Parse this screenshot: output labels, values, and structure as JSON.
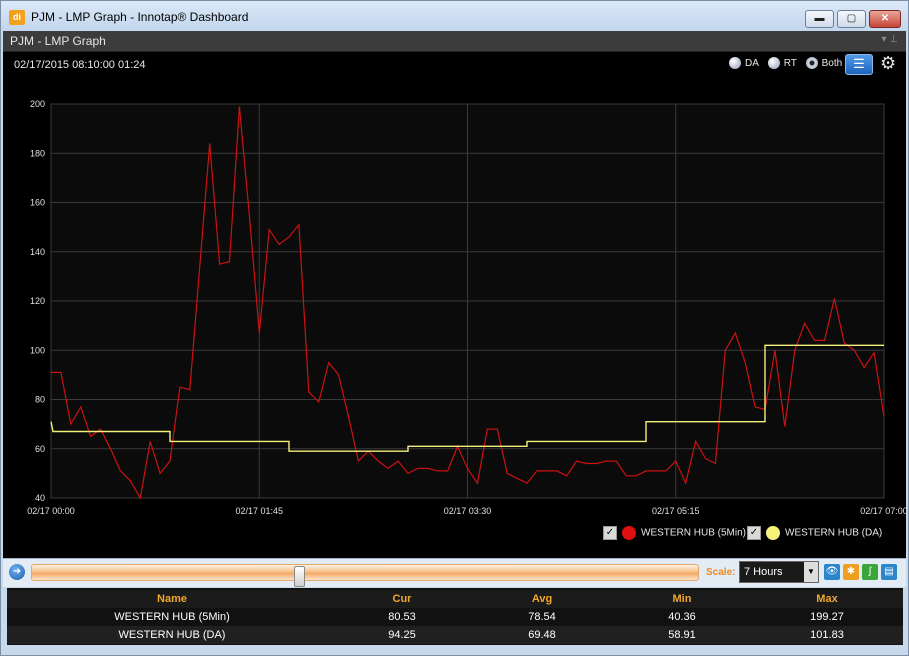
{
  "window": {
    "title": "PJM - LMP Graph - Innotap® Dashboard",
    "icon_text": "di",
    "buttons": {
      "minimize": "▬",
      "maximize": "▢",
      "close": "✕"
    }
  },
  "panel": {
    "title": "PJM - LMP Graph",
    "pin_icons": "▾ ⊥"
  },
  "header": {
    "datetime": "02/17/2015 08:10:00  01:24",
    "radios": [
      {
        "label": "DA",
        "selected": false
      },
      {
        "label": "RT",
        "selected": false
      },
      {
        "label": "Both",
        "selected": true
      }
    ],
    "list_icon": "☰",
    "gear_icon": "⚙"
  },
  "chart_data": {
    "type": "line",
    "ylim": [
      40,
      200
    ],
    "yticks": [
      "200",
      "180",
      "160",
      "140",
      "120",
      "100",
      "80",
      "60",
      "40"
    ],
    "ytick_values": [
      200,
      180,
      160,
      140,
      120,
      100,
      80,
      60,
      40
    ],
    "xlim_minutes": [
      0,
      420
    ],
    "xtick_labels": [
      "02/17 00:00",
      "02/17 01:45",
      "02/17 03:30",
      "02/17 05:15",
      "02/17 07:00"
    ],
    "xtick_minutes": [
      0,
      105,
      210,
      315,
      420
    ],
    "grid": true,
    "legend_position": "bottom-right",
    "series": [
      {
        "name": "WESTERN HUB (5Min)",
        "color": "#cc1111",
        "points": [
          [
            0,
            91
          ],
          [
            5,
            91
          ],
          [
            10,
            70
          ],
          [
            15,
            77
          ],
          [
            20,
            65
          ],
          [
            25,
            68
          ],
          [
            30,
            60
          ],
          [
            35,
            51
          ],
          [
            40,
            47
          ],
          [
            45,
            40
          ],
          [
            50,
            63
          ],
          [
            55,
            50
          ],
          [
            60,
            55
          ],
          [
            65,
            85
          ],
          [
            70,
            84
          ],
          [
            80,
            184
          ],
          [
            85,
            135
          ],
          [
            90,
            136
          ],
          [
            95,
            199
          ],
          [
            100,
            155
          ],
          [
            105,
            107
          ],
          [
            110,
            149
          ],
          [
            115,
            143
          ],
          [
            120,
            146
          ],
          [
            125,
            151
          ],
          [
            130,
            83
          ],
          [
            135,
            79
          ],
          [
            140,
            95
          ],
          [
            145,
            90
          ],
          [
            150,
            73
          ],
          [
            155,
            55
          ],
          [
            160,
            59
          ],
          [
            165,
            55
          ],
          [
            170,
            52
          ],
          [
            175,
            55
          ],
          [
            180,
            50
          ],
          [
            185,
            52
          ],
          [
            190,
            52
          ],
          [
            195,
            51
          ],
          [
            200,
            51
          ],
          [
            205,
            61
          ],
          [
            210,
            52
          ],
          [
            215,
            46
          ],
          [
            220,
            68
          ],
          [
            225,
            68
          ],
          [
            230,
            50
          ],
          [
            235,
            48
          ],
          [
            240,
            46
          ],
          [
            245,
            51
          ],
          [
            250,
            51
          ],
          [
            255,
            51
          ],
          [
            260,
            49
          ],
          [
            265,
            55
          ],
          [
            270,
            54
          ],
          [
            275,
            54
          ],
          [
            280,
            55
          ],
          [
            285,
            55
          ],
          [
            290,
            49
          ],
          [
            295,
            49
          ],
          [
            300,
            51
          ],
          [
            305,
            51
          ],
          [
            310,
            51
          ],
          [
            315,
            55
          ],
          [
            320,
            46
          ],
          [
            325,
            63
          ],
          [
            330,
            56
          ],
          [
            335,
            54
          ],
          [
            340,
            100
          ],
          [
            345,
            107
          ],
          [
            350,
            95
          ],
          [
            355,
            77
          ],
          [
            360,
            76
          ],
          [
            365,
            100
          ],
          [
            370,
            69
          ],
          [
            375,
            100
          ],
          [
            380,
            111
          ],
          [
            385,
            104
          ],
          [
            390,
            104
          ],
          [
            395,
            121
          ],
          [
            400,
            103
          ],
          [
            405,
            100
          ],
          [
            410,
            93
          ],
          [
            415,
            99
          ],
          [
            420,
            73
          ]
        ]
      },
      {
        "name": "WESTERN HUB (DA)",
        "color": "#f5f07a",
        "points": [
          [
            0,
            71
          ],
          [
            1,
            67
          ],
          [
            60,
            67
          ],
          [
            60,
            63
          ],
          [
            120,
            63
          ],
          [
            120,
            59
          ],
          [
            180,
            59
          ],
          [
            180,
            61
          ],
          [
            240,
            61
          ],
          [
            240,
            63
          ],
          [
            300,
            63
          ],
          [
            300,
            71
          ],
          [
            360,
            71
          ],
          [
            360,
            102
          ],
          [
            420,
            102
          ]
        ]
      }
    ]
  },
  "legend": {
    "items": [
      {
        "label": "WESTERN HUB (5Min)",
        "check": "✓",
        "color": "#e01010"
      },
      {
        "label": "WESTERN HUB (DA)",
        "check": "✓",
        "color": "#f7f27a"
      }
    ]
  },
  "toolbar": {
    "nav_icon": "➜",
    "slider_position": 0.4,
    "scale_label": "Scale:",
    "scale_value": "7 Hours",
    "dropdown_arrow": "▼",
    "icons": [
      "👁",
      "✱",
      "∫",
      "▤"
    ]
  },
  "table": {
    "columns": [
      "Name",
      "Cur",
      "Avg",
      "Min",
      "Max"
    ],
    "rows": [
      [
        "WESTERN HUB (5Min)",
        "80.53",
        "78.54",
        "40.36",
        "199.27"
      ],
      [
        "WESTERN HUB (DA)",
        "94.25",
        "69.48",
        "58.91",
        "101.83"
      ]
    ]
  }
}
